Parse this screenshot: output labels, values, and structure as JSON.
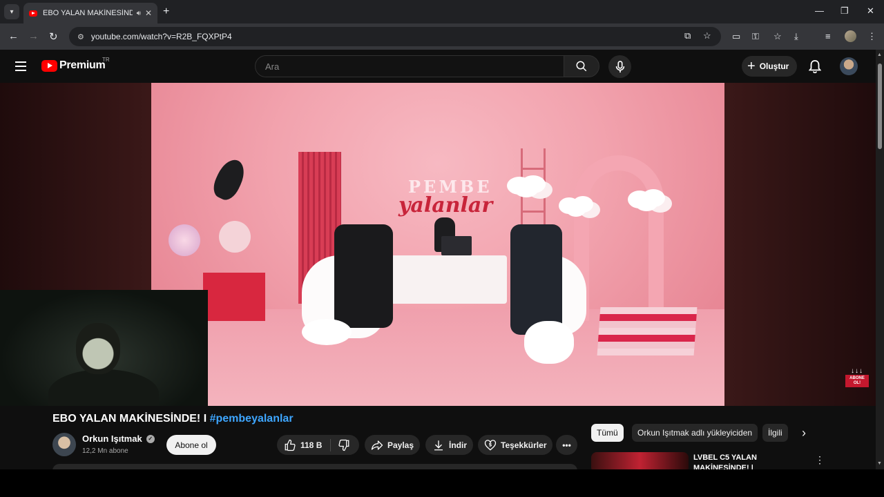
{
  "browser": {
    "tab_title": "EBO YALAN MAKİNESİNDE!",
    "url": "youtube.com/watch?v=R2B_FQXPtP4"
  },
  "masthead": {
    "brand": "Premium",
    "region": "TR",
    "search_placeholder": "Ara",
    "create_label": "Oluştur"
  },
  "overlay": {
    "subscribe_text": "ABONE OL!",
    "arrows": "↓↓↓"
  },
  "video": {
    "sign_line1": "PEMBE",
    "sign_line2": "yalanlar"
  },
  "watch": {
    "title_text": "EBO YALAN MAKİNESİNDE! I ",
    "title_hashtag": "#pembeyalanlar",
    "channel_name": "Orkun Işıtmak",
    "subscribers": "12,2 Mn abone",
    "subscribe_label": "Abone ol",
    "likes": "118 B",
    "share_label": "Paylaş",
    "download_label": "İndir",
    "thanks_label": "Teşekkürler"
  },
  "chips": [
    "Tümü",
    "Orkun Işıtmak adlı yükleyiciden",
    "İlgili"
  ],
  "recommendation": {
    "title": "LVBEL C5 YALAN MAKİNESİNDE! |"
  },
  "colors": {
    "youtube_red": "#ff0000",
    "link_blue": "#3ea6ff",
    "background": "#0f0f0f"
  }
}
